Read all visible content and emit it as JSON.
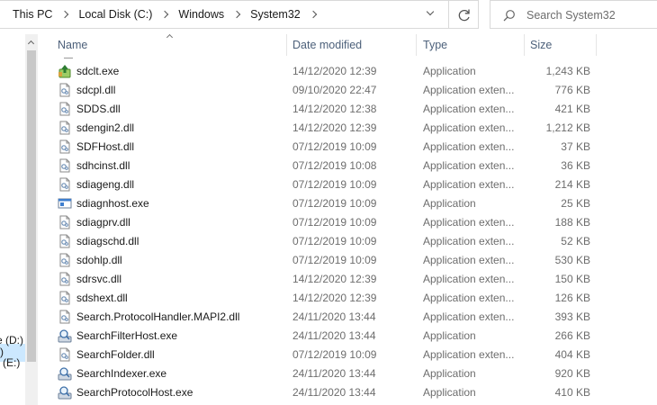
{
  "address_bar": {
    "breadcrumbs": [
      "This PC",
      "Local Disk (C:)",
      "Windows",
      "System32"
    ]
  },
  "search": {
    "placeholder": "Search System32"
  },
  "nav_pane": {
    "partial_items": [
      ")",
      "e (D:)",
      "(E:)"
    ]
  },
  "columns": {
    "name": "Name",
    "date": "Date modified",
    "type": "Type",
    "size": "Size"
  },
  "files": [
    {
      "name": "sdclt.exe",
      "date": "14/12/2020 12:39",
      "type": "Application",
      "size": "1,243 KB",
      "icon": "backup-app-icon"
    },
    {
      "name": "sdcpl.dll",
      "date": "09/10/2020 22:47",
      "type": "Application exten...",
      "size": "776 KB",
      "icon": "dll-icon"
    },
    {
      "name": "SDDS.dll",
      "date": "14/12/2020 12:38",
      "type": "Application exten...",
      "size": "421 KB",
      "icon": "dll-icon"
    },
    {
      "name": "sdengin2.dll",
      "date": "14/12/2020 12:39",
      "type": "Application exten...",
      "size": "1,212 KB",
      "icon": "dll-icon"
    },
    {
      "name": "SDFHost.dll",
      "date": "07/12/2019 10:09",
      "type": "Application exten...",
      "size": "37 KB",
      "icon": "dll-icon"
    },
    {
      "name": "sdhcinst.dll",
      "date": "07/12/2019 10:08",
      "type": "Application exten...",
      "size": "36 KB",
      "icon": "dll-icon"
    },
    {
      "name": "sdiageng.dll",
      "date": "07/12/2019 10:09",
      "type": "Application exten...",
      "size": "214 KB",
      "icon": "dll-icon"
    },
    {
      "name": "sdiagnhost.exe",
      "date": "07/12/2019 10:09",
      "type": "Application",
      "size": "25 KB",
      "icon": "exe-window-icon"
    },
    {
      "name": "sdiagprv.dll",
      "date": "07/12/2019 10:09",
      "type": "Application exten...",
      "size": "188 KB",
      "icon": "dll-icon"
    },
    {
      "name": "sdiagschd.dll",
      "date": "07/12/2019 10:09",
      "type": "Application exten...",
      "size": "52 KB",
      "icon": "dll-icon"
    },
    {
      "name": "sdohlp.dll",
      "date": "07/12/2019 10:09",
      "type": "Application exten...",
      "size": "530 KB",
      "icon": "dll-icon"
    },
    {
      "name": "sdrsvc.dll",
      "date": "14/12/2020 12:39",
      "type": "Application exten...",
      "size": "150 KB",
      "icon": "dll-icon"
    },
    {
      "name": "sdshext.dll",
      "date": "14/12/2020 12:39",
      "type": "Application exten...",
      "size": "126 KB",
      "icon": "dll-icon"
    },
    {
      "name": "Search.ProtocolHandler.MAPI2.dll",
      "date": "24/11/2020 13:44",
      "type": "Application exten...",
      "size": "393 KB",
      "icon": "dll-icon"
    },
    {
      "name": "SearchFilterHost.exe",
      "date": "24/11/2020 13:44",
      "type": "Application",
      "size": "266 KB",
      "icon": "search-exe-icon"
    },
    {
      "name": "SearchFolder.dll",
      "date": "07/12/2019 10:09",
      "type": "Application exten...",
      "size": "404 KB",
      "icon": "dll-icon"
    },
    {
      "name": "SearchIndexer.exe",
      "date": "24/11/2020 13:44",
      "type": "Application",
      "size": "920 KB",
      "icon": "search-exe-icon"
    },
    {
      "name": "SearchProtocolHost.exe",
      "date": "24/11/2020 13:44",
      "type": "Application",
      "size": "410 KB",
      "icon": "search-exe-icon"
    }
  ],
  "colors": {
    "header_text": "#4c607a",
    "secondary_text": "#6d6d6d",
    "selection": "#cce8ff"
  }
}
